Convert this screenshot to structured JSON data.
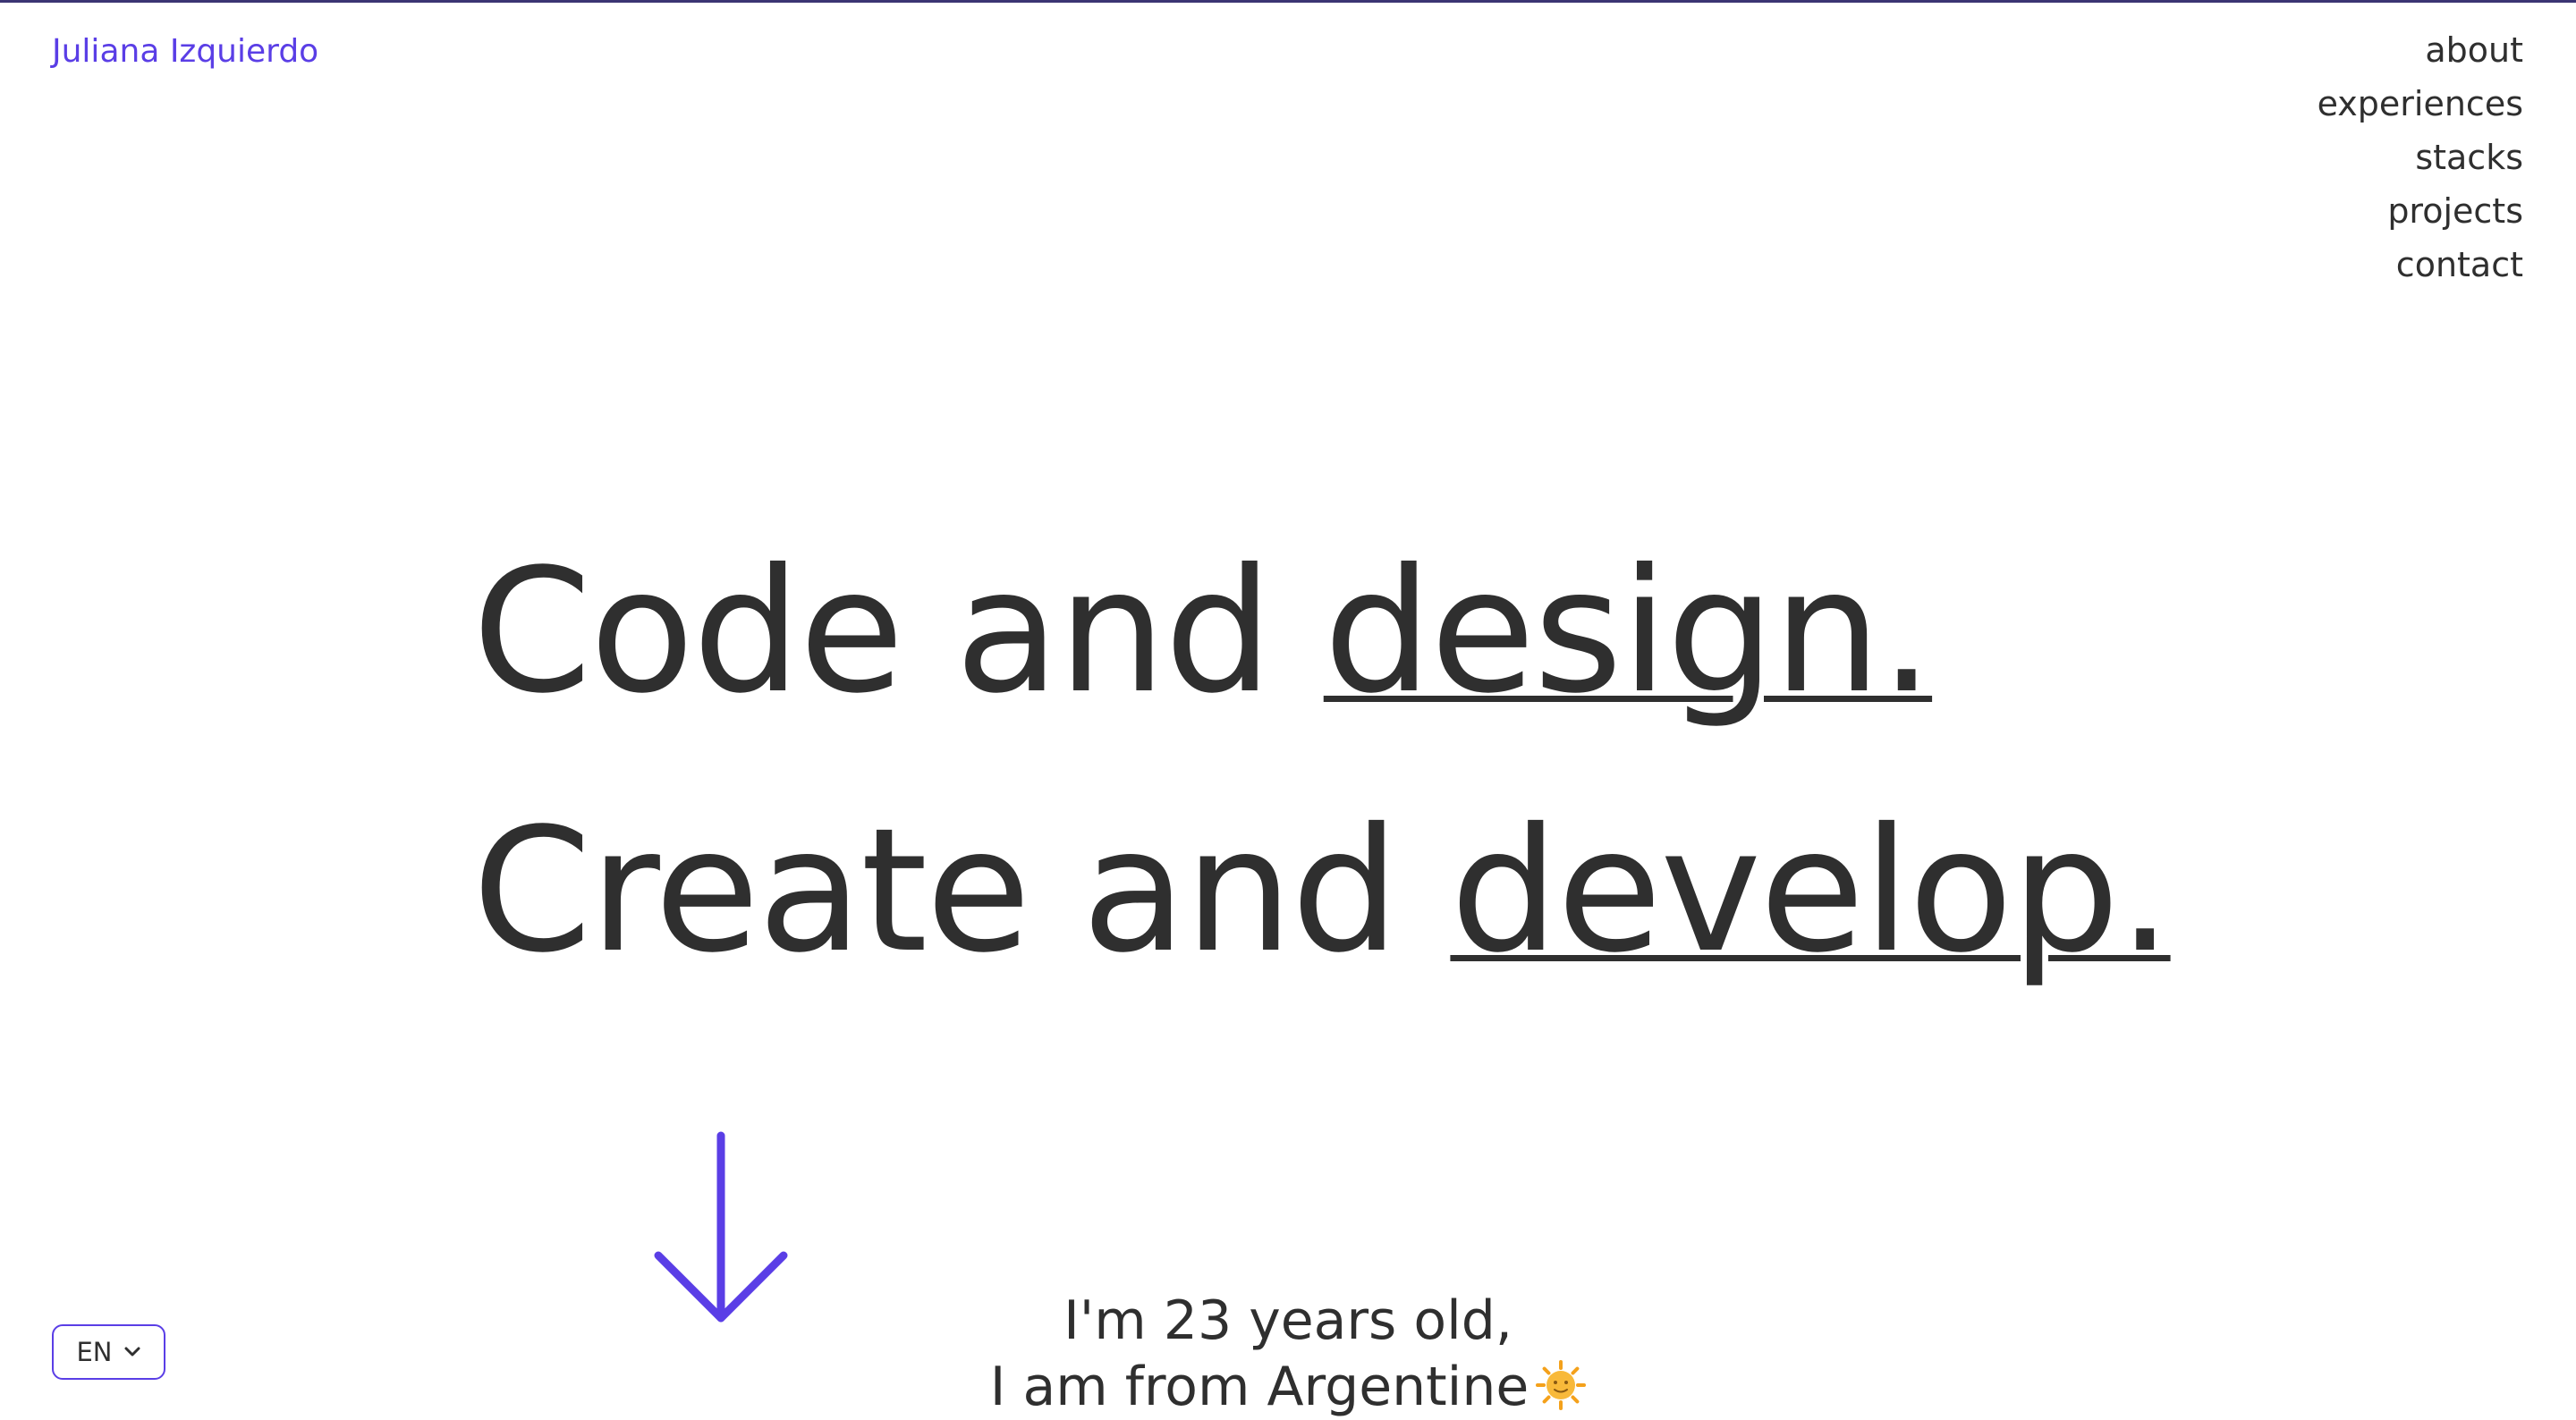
{
  "header": {
    "brand": "Juliana Izquierdo"
  },
  "nav": {
    "items": [
      {
        "label": "about"
      },
      {
        "label": "experiences"
      },
      {
        "label": "stacks"
      },
      {
        "label": "projects"
      },
      {
        "label": "contact"
      }
    ]
  },
  "hero": {
    "line1_prefix": "Code and ",
    "line1_emphasis": "design.",
    "line2_prefix": "Create and ",
    "line2_emphasis": "develop."
  },
  "intro": {
    "line1": "I'm 23 years old,",
    "line2": "I am from Argentine"
  },
  "language": {
    "selected": "EN"
  },
  "icons": {
    "scroll": "arrow-down-icon",
    "language_toggle": "chevron-down-icon",
    "emoji": "sun-icon"
  },
  "colors": {
    "accent": "#5a3ee6",
    "text": "#2f2f2f",
    "top_border": "#3b3573",
    "background": "#ffffff"
  }
}
